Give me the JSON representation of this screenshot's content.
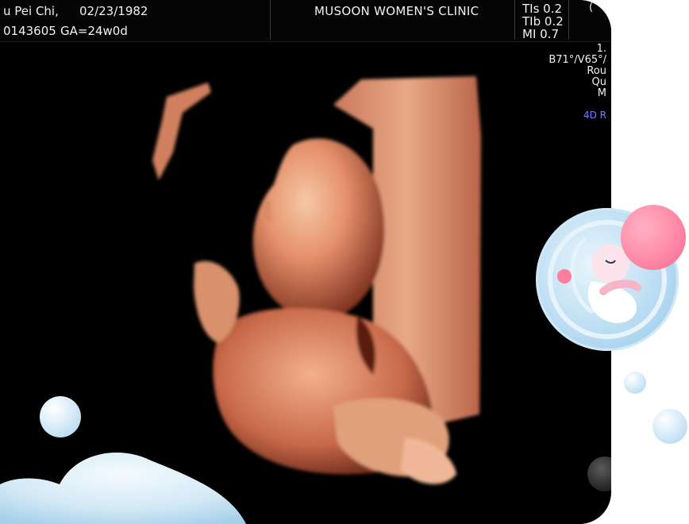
{
  "header": {
    "patient_name": "u Pei Chi,",
    "birth_date": "02/23/1982",
    "patient_id": "0143605",
    "gestational_age": "GA=24w0d",
    "clinic_name": "MUSOON WOMEN'S CLINIC",
    "index_tis": "TIs  0.2",
    "index_tib": "TIb  0.2",
    "index_mi": "MI  0.7",
    "corner_char": "("
  },
  "side_panel": {
    "line1": "1.",
    "line2": "B71°/V65°/",
    "line3": "Rou",
    "line4": "Qu",
    "line5": "M",
    "mode_label": "4D R"
  },
  "colors": {
    "background": "#000000",
    "page": "#ffffff",
    "header_text": "#f2f2f2",
    "mode_label": "#7f7aff",
    "skin_tone": "#e5906b",
    "bubble_blue": "#a9d2ee",
    "pink": "#ff8aa8"
  },
  "icons": {
    "baby_badge": "fetus-in-bubble-icon",
    "control_knob": "trackball-icon"
  }
}
